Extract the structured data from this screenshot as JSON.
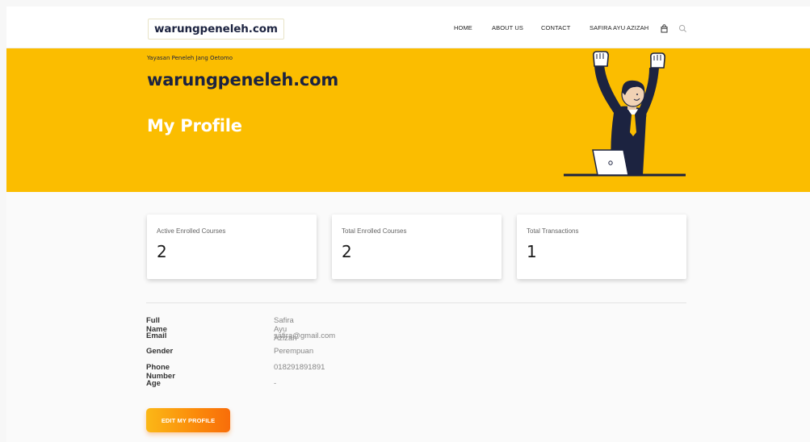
{
  "header": {
    "logo": "warungpeneleh.com",
    "nav": [
      "HOME",
      "ABOUT US",
      "CONTACT",
      "SAFIRA AYU AZIZAH"
    ],
    "icons": [
      "cart-icon",
      "search-icon"
    ]
  },
  "hero": {
    "org": "Yayasan Peneleh Jang Oetomo",
    "site": "warungpeneleh.com",
    "title": "My Profile",
    "background": "#fbbd00"
  },
  "stats": [
    {
      "label": "Active Enrolled Courses",
      "value": "2"
    },
    {
      "label": "Total Enrolled Courses",
      "value": "2"
    },
    {
      "label": "Total Transactions",
      "value": "1"
    }
  ],
  "profile": [
    {
      "label": "Full Name",
      "value": "Safira Ayu Azizah"
    },
    {
      "label": "Email",
      "value": "safira@gmail.com"
    },
    {
      "label": "Gender",
      "value": "Perempuan"
    },
    {
      "label": "Phone Number",
      "value": "018291891891"
    },
    {
      "label": "Age",
      "value": "-"
    }
  ],
  "actions": {
    "edit_profile": "EDIT MY PROFILE"
  }
}
